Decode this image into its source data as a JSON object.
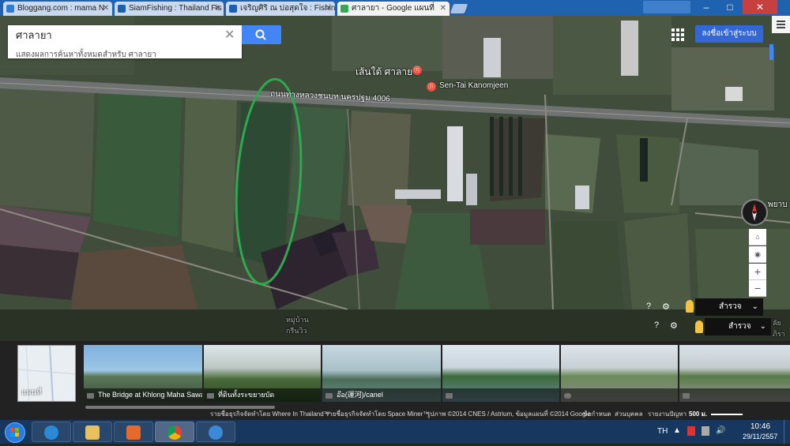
{
  "browser": {
    "tabs": [
      {
        "title": "Bloggang.com : mama N",
        "favicon_color": "#2e7bd8"
      },
      {
        "title": "SiamFishing : Thailand Fis",
        "favicon_color": "#1a5fb4"
      },
      {
        "title": "เจริญศิริ ณ บ่อสุดใจ : Fishing",
        "favicon_color": "#1a5fb4"
      },
      {
        "title": "ศาลายา - Google แผนที่",
        "favicon_color": "#34a853"
      }
    ],
    "window_controls": {
      "minimize": "–",
      "maximize": "□",
      "close": "✕"
    }
  },
  "search": {
    "query": "ศาลายา",
    "hint": "แสดงผลการค้นหาทั้งหมดสำหรับ ศาลายา",
    "signin_label": "ลงชื่อเข้าสู่ระบบ"
  },
  "map": {
    "labels": {
      "place_th": "เส้นใต้ ศาลายา",
      "place_en": "Sen-Tai Kanomjeen",
      "road": "ถนนทางหลวงชนบท นครปฐม 4006",
      "village": "หมู่บ้าน\nกรีนวิว",
      "edge_right_1": "พยาบ",
      "edge_right_2": "ลัย\nภิรา"
    },
    "controls": {
      "zoom_in": "+",
      "zoom_out": "−",
      "explore_label": "สำรวจ",
      "explore_label_2": "สำรวจ"
    },
    "highlight_color": "#2fa84f"
  },
  "photos": {
    "map_thumb_label": "แผนที่",
    "items": [
      {
        "caption": "The Bridge at Khlong Maha Sawat"
      },
      {
        "caption": "ที่ดินทั้งระขยายบัด"
      },
      {
        "caption": "อ๊อ(運河)/canel"
      },
      {
        "caption": ""
      },
      {
        "caption": ""
      },
      {
        "caption": ""
      }
    ]
  },
  "footer": {
    "credit1": "รายชื่อธุรกิจจัดทำโดย Where In Thailand™",
    "credit2": "รายชื่อธุรกิจจัดทำโดย Space Miner™",
    "credit3": "รูปภาพ ©2014 CNES / Astrium, ข้อมูลแผนที่ ©2014 Google",
    "terms": "ข้อกำหนด",
    "privacy": "ส่วนบุคคล",
    "report": "รายงานปัญหา",
    "scale": "500 ม."
  },
  "taskbar": {
    "lang": "TH",
    "time": "10:46",
    "date": "29/11/2557"
  }
}
